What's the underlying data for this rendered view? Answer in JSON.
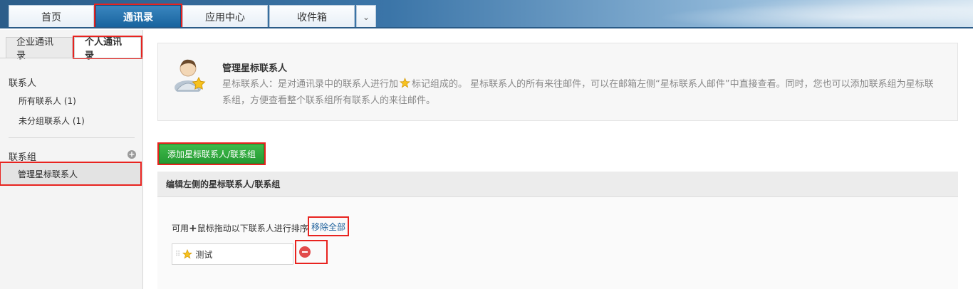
{
  "top_tabs": [
    {
      "label": "首页"
    },
    {
      "label": "通讯录"
    },
    {
      "label": "应用中心"
    },
    {
      "label": "收件箱"
    }
  ],
  "more_glyph": "⌄",
  "sidebar": {
    "tabs": [
      {
        "label": "企业通讯录"
      },
      {
        "label": "个人通讯录"
      }
    ],
    "contacts_section": "联系人",
    "contact_items": [
      {
        "label": "所有联系人 (1)"
      },
      {
        "label": "未分组联系人 (1)"
      }
    ],
    "groups_section": "联系组",
    "add_group_glyph": "+",
    "selected_item": "管理星标联系人"
  },
  "info": {
    "title": "管理星标联系人",
    "desc_part1": "星标联系人：是对通讯录中的联系人进行加",
    "desc_part2": "标记组成的。 星标联系人的所有来往邮件，可以在邮箱左侧“星标联系人邮件”中直接查看。同时，您也可以添加联系组为星标联系组，方便查看整个联系组所有联系人的来往邮件。"
  },
  "add_button": "添加星标联系人/联系组",
  "edit_panel": {
    "heading": "编辑左侧的星标联系人/联系组",
    "hint_before": "可用",
    "hint_plus": "+",
    "hint_after": "鼠标拖动以下联系人进行排序",
    "remove_all": "移除全部",
    "items": [
      {
        "name": "测试"
      }
    ]
  },
  "colors": {
    "accent": "#16619c",
    "green": "#259a33",
    "highlight": "#e8231f",
    "remove": "#e24b4b"
  }
}
